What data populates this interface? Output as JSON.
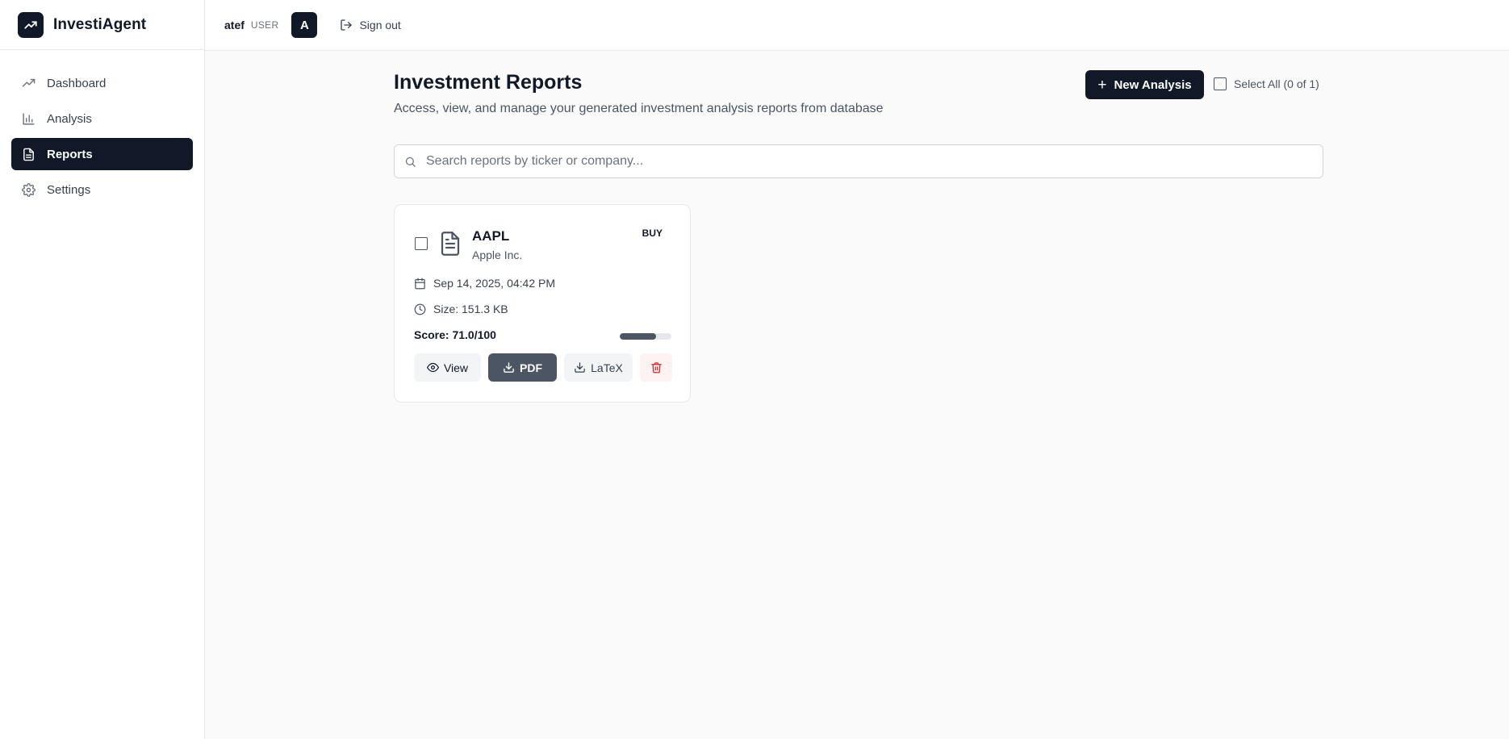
{
  "app": {
    "name": "InvestiAgent",
    "logo_icon": "trending-up-icon"
  },
  "sidebar": {
    "items": [
      {
        "label": "Dashboard",
        "icon": "trending-up-icon",
        "active": false
      },
      {
        "label": "Analysis",
        "icon": "bar-chart-icon",
        "active": false
      },
      {
        "label": "Reports",
        "icon": "file-text-icon",
        "active": true
      },
      {
        "label": "Settings",
        "icon": "gear-icon",
        "active": false
      }
    ]
  },
  "topbar": {
    "username": "atef",
    "role": "USER",
    "avatar_letter": "A",
    "signout_label": "Sign out"
  },
  "page": {
    "title": "Investment Reports",
    "subtitle": "Access, view, and manage your generated investment analysis reports from database",
    "new_analysis_label": "New Analysis",
    "select_all_label": "Select All (0 of 1)",
    "search_placeholder": "Search reports by ticker or company..."
  },
  "reports": [
    {
      "ticker": "AAPL",
      "company": "Apple Inc.",
      "recommendation": "BUY",
      "date": "Sep 14, 2025, 04:42 PM",
      "size": "Size: 151.3 KB",
      "score_text": "Score: 71.0/100",
      "score_fraction": 0.71,
      "selected": false,
      "actions": {
        "view": "View",
        "pdf": "PDF",
        "latex": "LaTeX"
      }
    }
  ],
  "colors": {
    "primary": "#111827",
    "accent_gray": "#4b5563",
    "delete_red": "#dc2626",
    "background": "#fafafa"
  }
}
